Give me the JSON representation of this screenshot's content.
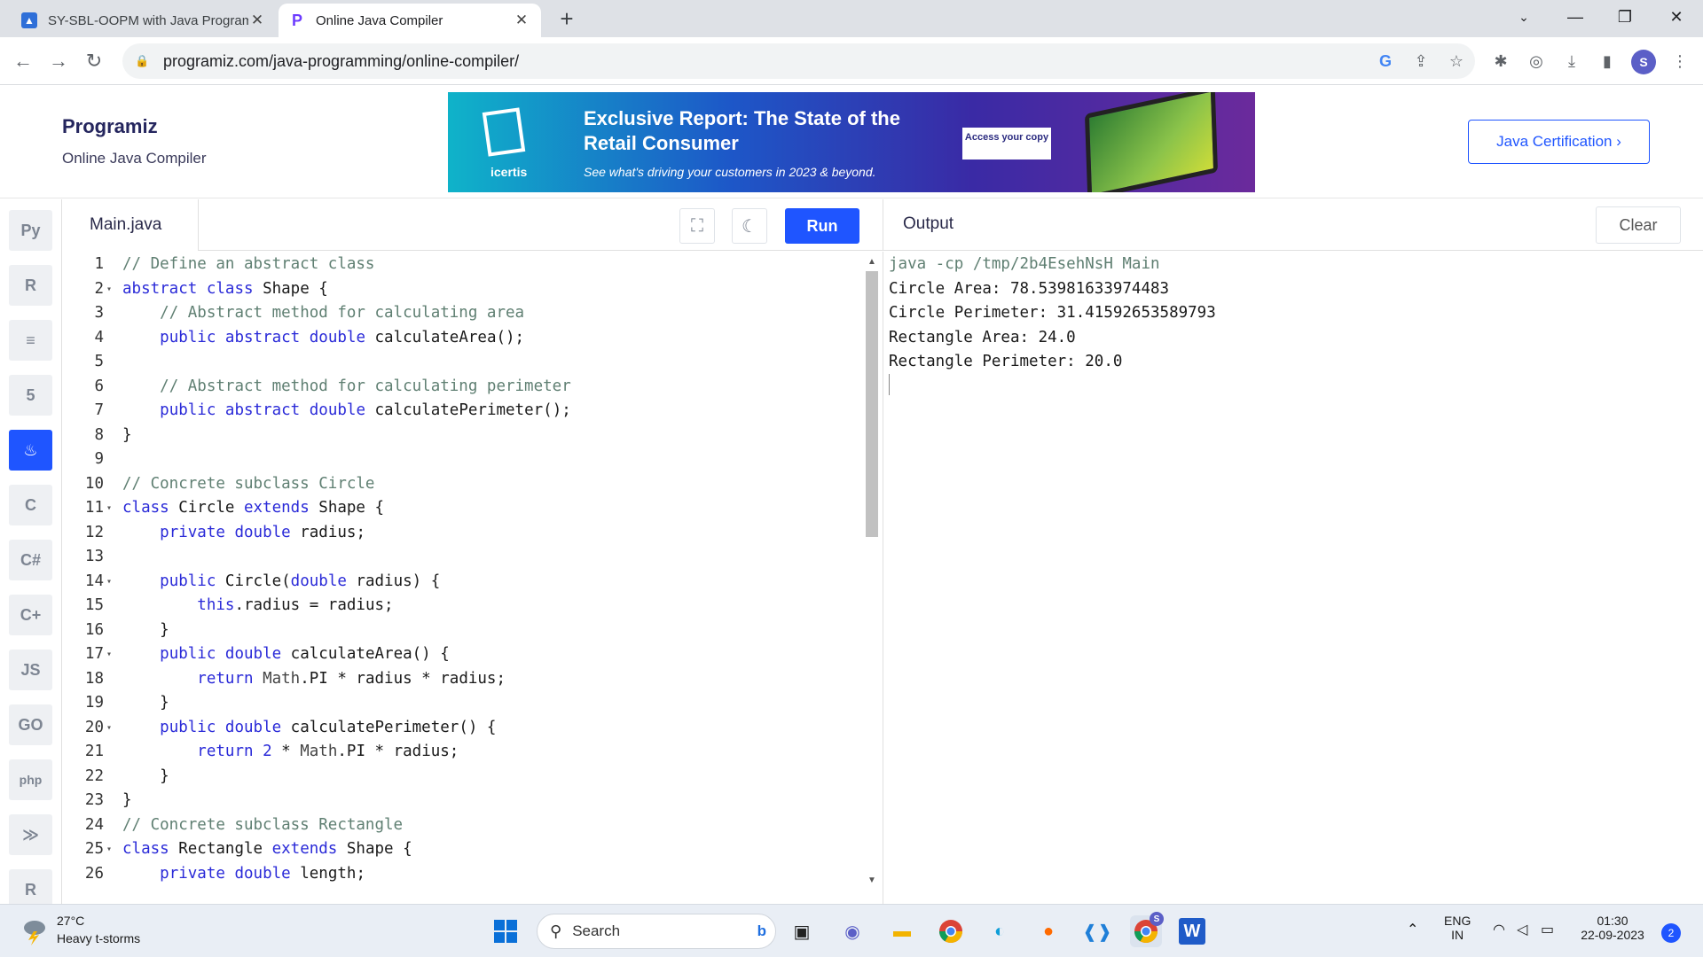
{
  "browser": {
    "tabs": [
      {
        "title": "SY-SBL-OOPM with Java Program"
      },
      {
        "title": "Online Java Compiler"
      }
    ],
    "url": "programiz.com/java-programming/online-compiler/"
  },
  "site": {
    "logo": "Programiz",
    "subtitle": "Online Java Compiler",
    "certification_button": "Java Certification ›",
    "ad": {
      "brand": "icertis",
      "title": "Exclusive Report: The State of the Retail Consumer",
      "subtitle": "See what's driving your customers in 2023 & beyond.",
      "cta": "Access your copy"
    }
  },
  "sidebar": {
    "languages": [
      {
        "icon": "python-icon",
        "glyph": "Py"
      },
      {
        "icon": "r-icon",
        "glyph": "R"
      },
      {
        "icon": "sql-icon",
        "glyph": "≡"
      },
      {
        "icon": "html-icon",
        "glyph": "5"
      },
      {
        "icon": "java-icon",
        "glyph": "♨",
        "active": true
      },
      {
        "icon": "c-icon",
        "glyph": "C"
      },
      {
        "icon": "csharp-icon",
        "glyph": "C#"
      },
      {
        "icon": "cpp-icon",
        "glyph": "C+"
      },
      {
        "icon": "js-icon",
        "glyph": "JS"
      },
      {
        "icon": "go-icon",
        "glyph": "GO"
      },
      {
        "icon": "php-icon",
        "glyph": "php"
      },
      {
        "icon": "swift-icon",
        "glyph": "≫"
      },
      {
        "icon": "rust-icon",
        "glyph": "R"
      }
    ]
  },
  "editor": {
    "file_name": "Main.java",
    "run_label": "Run",
    "lines": [
      "// Define an abstract class",
      "abstract class Shape {",
      "    // Abstract method for calculating area",
      "    public abstract double calculateArea();",
      "",
      "    // Abstract method for calculating perimeter",
      "    public abstract double calculatePerimeter();",
      "}",
      "",
      "// Concrete subclass Circle",
      "class Circle extends Shape {",
      "    private double radius;",
      "",
      "    public Circle(double radius) {",
      "        this.radius = radius;",
      "    }",
      "    public double calculateArea() {",
      "        return Math.PI * radius * radius;",
      "    }",
      "    public double calculatePerimeter() {",
      "        return 2 * Math.PI * radius;",
      "    }",
      "}",
      "// Concrete subclass Rectangle",
      "class Rectangle extends Shape {",
      "    private double length;"
    ],
    "fold_lines": [
      2,
      11,
      14,
      17,
      20,
      25
    ]
  },
  "output": {
    "title": "Output",
    "clear_label": "Clear",
    "lines": [
      "java -cp /tmp/2b4EsehNsH Main",
      "Circle Area: 78.53981633974483",
      "Circle Perimeter: 31.41592653589793",
      "Rectangle Area: 24.0",
      "Rectangle Perimeter: 20.0"
    ]
  },
  "taskbar": {
    "weather_temp": "27°C",
    "weather_desc": "Heavy t-storms",
    "search_placeholder": "Search",
    "lang": "ENG",
    "region": "IN",
    "time": "01:30",
    "date": "22-09-2023",
    "notifications": "2",
    "chrome_badge": "S"
  },
  "profile_initial": "S"
}
